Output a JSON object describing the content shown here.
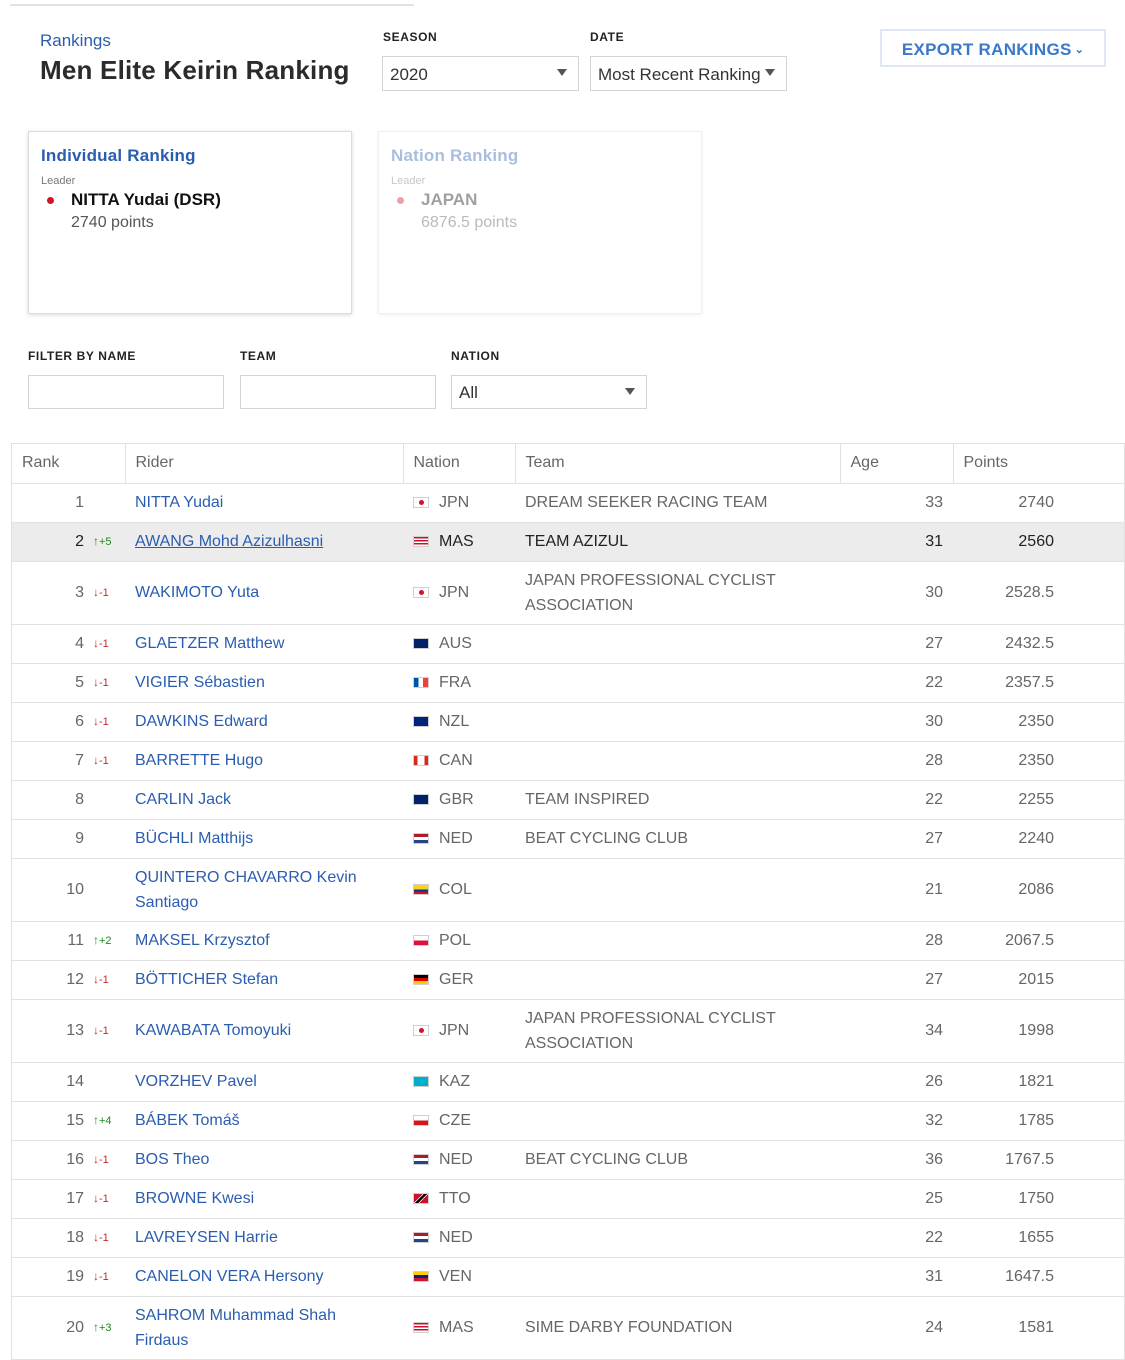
{
  "header": {
    "breadcrumb": "Rankings",
    "title": "Men Elite Keirin Ranking",
    "season_label": "SEASON",
    "season_value": "2020",
    "date_label": "DATE",
    "date_value": "Most Recent Ranking",
    "export_label": "EXPORT RANKINGS"
  },
  "cards": {
    "individual": {
      "title": "Individual Ranking",
      "leader_label": "Leader",
      "leader": "NITTA Yudai (DSR)",
      "points": "2740 points"
    },
    "nation": {
      "title": "Nation Ranking",
      "leader_label": "Leader",
      "leader": "JAPAN",
      "points": "6876.5 points"
    }
  },
  "filters": {
    "name_label": "FILTER BY NAME",
    "team_label": "TEAM",
    "nation_label": "NATION",
    "nation_value": "All"
  },
  "table": {
    "columns": [
      "Rank",
      "Rider",
      "Nation",
      "Team",
      "Age",
      "Points"
    ],
    "rows": [
      {
        "rank": "1",
        "move": "",
        "dir": "",
        "rider": "NITTA Yudai",
        "flag": "jpn",
        "nation": "JPN",
        "team": "DREAM SEEKER RACING TEAM",
        "age": "33",
        "points": "2740"
      },
      {
        "rank": "2",
        "move": "+5",
        "dir": "up",
        "rider": "AWANG Mohd Azizulhasni",
        "flag": "mas",
        "nation": "MAS",
        "team": "TEAM AZIZUL",
        "age": "31",
        "points": "2560"
      },
      {
        "rank": "3",
        "move": "-1",
        "dir": "down",
        "rider": "WAKIMOTO Yuta",
        "flag": "jpn",
        "nation": "JPN",
        "team": "JAPAN PROFESSIONAL CYCLIST ASSOCIATION",
        "age": "30",
        "points": "2528.5"
      },
      {
        "rank": "4",
        "move": "-1",
        "dir": "down",
        "rider": "GLAETZER Matthew",
        "flag": "aus",
        "nation": "AUS",
        "team": "",
        "age": "27",
        "points": "2432.5"
      },
      {
        "rank": "5",
        "move": "-1",
        "dir": "down",
        "rider": "VIGIER Sébastien",
        "flag": "fra",
        "nation": "FRA",
        "team": "",
        "age": "22",
        "points": "2357.5"
      },
      {
        "rank": "6",
        "move": "-1",
        "dir": "down",
        "rider": "DAWKINS Edward",
        "flag": "nzl",
        "nation": "NZL",
        "team": "",
        "age": "30",
        "points": "2350"
      },
      {
        "rank": "7",
        "move": "-1",
        "dir": "down",
        "rider": "BARRETTE Hugo",
        "flag": "can",
        "nation": "CAN",
        "team": "",
        "age": "28",
        "points": "2350"
      },
      {
        "rank": "8",
        "move": "",
        "dir": "",
        "rider": "CARLIN Jack",
        "flag": "gbr",
        "nation": "GBR",
        "team": "TEAM INSPIRED",
        "age": "22",
        "points": "2255"
      },
      {
        "rank": "9",
        "move": "",
        "dir": "",
        "rider": "BÜCHLI Matthijs",
        "flag": "ned",
        "nation": "NED",
        "team": "BEAT CYCLING CLUB",
        "age": "27",
        "points": "2240"
      },
      {
        "rank": "10",
        "move": "",
        "dir": "",
        "rider": "QUINTERO CHAVARRO Kevin Santiago",
        "flag": "col",
        "nation": "COL",
        "team": "",
        "age": "21",
        "points": "2086"
      },
      {
        "rank": "11",
        "move": "+2",
        "dir": "up",
        "rider": "MAKSEL Krzysztof",
        "flag": "pol",
        "nation": "POL",
        "team": "",
        "age": "28",
        "points": "2067.5"
      },
      {
        "rank": "12",
        "move": "-1",
        "dir": "down",
        "rider": "BÖTTICHER Stefan",
        "flag": "ger",
        "nation": "GER",
        "team": "",
        "age": "27",
        "points": "2015"
      },
      {
        "rank": "13",
        "move": "-1",
        "dir": "down",
        "rider": "KAWABATA Tomoyuki",
        "flag": "jpn",
        "nation": "JPN",
        "team": "JAPAN PROFESSIONAL CYCLIST ASSOCIATION",
        "age": "34",
        "points": "1998"
      },
      {
        "rank": "14",
        "move": "",
        "dir": "",
        "rider": "VORZHEV Pavel",
        "flag": "kaz",
        "nation": "KAZ",
        "team": "",
        "age": "26",
        "points": "1821"
      },
      {
        "rank": "15",
        "move": "+4",
        "dir": "up",
        "rider": "BÁBEK Tomáš",
        "flag": "cze",
        "nation": "CZE",
        "team": "",
        "age": "32",
        "points": "1785"
      },
      {
        "rank": "16",
        "move": "-1",
        "dir": "down",
        "rider": "BOS Theo",
        "flag": "ned",
        "nation": "NED",
        "team": "BEAT CYCLING CLUB",
        "age": "36",
        "points": "1767.5"
      },
      {
        "rank": "17",
        "move": "-1",
        "dir": "down",
        "rider": "BROWNE Kwesi",
        "flag": "tto",
        "nation": "TTO",
        "team": "",
        "age": "25",
        "points": "1750"
      },
      {
        "rank": "18",
        "move": "-1",
        "dir": "down",
        "rider": "LAVREYSEN Harrie",
        "flag": "ned",
        "nation": "NED",
        "team": "",
        "age": "22",
        "points": "1655"
      },
      {
        "rank": "19",
        "move": "-1",
        "dir": "down",
        "rider": "CANELON VERA Hersony",
        "flag": "ven",
        "nation": "VEN",
        "team": "",
        "age": "31",
        "points": "1647.5"
      },
      {
        "rank": "20",
        "move": "+3",
        "dir": "up",
        "rider": "SAHROM Muhammad Shah Firdaus",
        "flag": "mas",
        "nation": "MAS",
        "team": "SIME DARBY FOUNDATION",
        "age": "24",
        "points": "1581"
      }
    ]
  }
}
